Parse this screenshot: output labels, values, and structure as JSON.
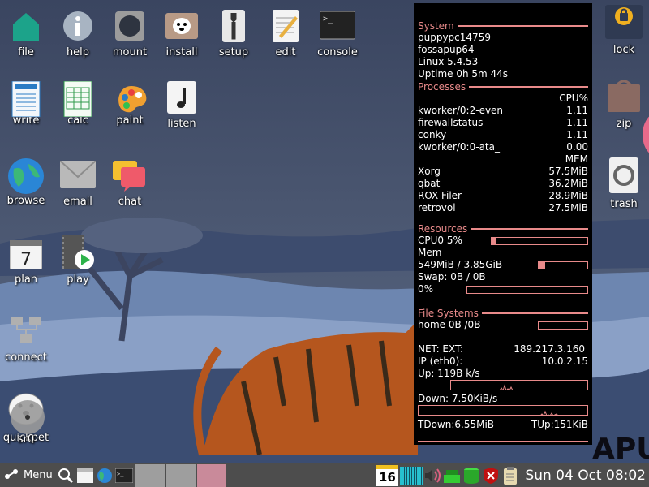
{
  "desktop": {
    "icons": {
      "file": "file",
      "help": "help",
      "mount": "mount",
      "install": "install",
      "setup": "setup",
      "edit": "edit",
      "console": "console",
      "write": "write",
      "calc": "calc",
      "paint": "paint",
      "listen": "listen",
      "browse": "browse",
      "email": "email",
      "chat": "chat",
      "plan": "plan",
      "plan_day": "7",
      "play": "play",
      "connect": "connect",
      "quickpet": "quickpet",
      "sr0": "sr0",
      "lock": "lock",
      "zip": "zip",
      "trash": "trash"
    },
    "wallpaper_text": "APU"
  },
  "conky": {
    "system": {
      "header": "System",
      "hostname": "puppypc14759",
      "distro": "fossapup64",
      "kernel": "Linux 5.4.53",
      "uptime": "Uptime 0h 5m 44s"
    },
    "processes": {
      "header": "Processes",
      "cpu_header": "CPU%",
      "cpu_list": [
        {
          "name": "kworker/0:2-even",
          "value": "1.11"
        },
        {
          "name": "firewallstatus",
          "value": "1.11"
        },
        {
          "name": "conky",
          "value": "1.11"
        },
        {
          "name": "kworker/0:0-ata_",
          "value": "0.00"
        }
      ],
      "mem_header": "MEM",
      "mem_list": [
        {
          "name": "Xorg",
          "value": "57.5MiB"
        },
        {
          "name": "qbat",
          "value": "36.2MiB"
        },
        {
          "name": "ROX-Filer",
          "value": "28.9MiB"
        },
        {
          "name": "retrovol",
          "value": "27.5MiB"
        }
      ]
    },
    "resources": {
      "header": "Resources",
      "cpu_label": "CPU0 5%",
      "cpu_fraction": 0.05,
      "mem_label": "Mem",
      "mem_value": "549MiB / 3.85GiB",
      "mem_fraction": 0.14,
      "swap_label": "Swap: 0B   / 0B",
      "swap_percent": "0%",
      "swap_fraction": 0
    },
    "filesystems": {
      "header": "File Systems",
      "home": "home 0B  /0B",
      "home_fraction": 0
    },
    "network": {
      "ext_label": "NET: EXT:",
      "ext_ip": "189.217.3.160",
      "int_label": "IP (eth0):",
      "int_ip": "10.0.2.15",
      "up_label": " Up: 119B   k/s",
      "down_label": " Down: 7.50KiB/s",
      "tdown": "TDown:6.55MiB",
      "tup": "TUp:151KiB"
    },
    "colors": {
      "accent": "#e88a8a",
      "background": "#000000",
      "text": "#ffffff"
    }
  },
  "taskbar": {
    "menu_label": "Menu",
    "calendar_day": "16",
    "clock": "Sun 04 Oct 08:02"
  }
}
